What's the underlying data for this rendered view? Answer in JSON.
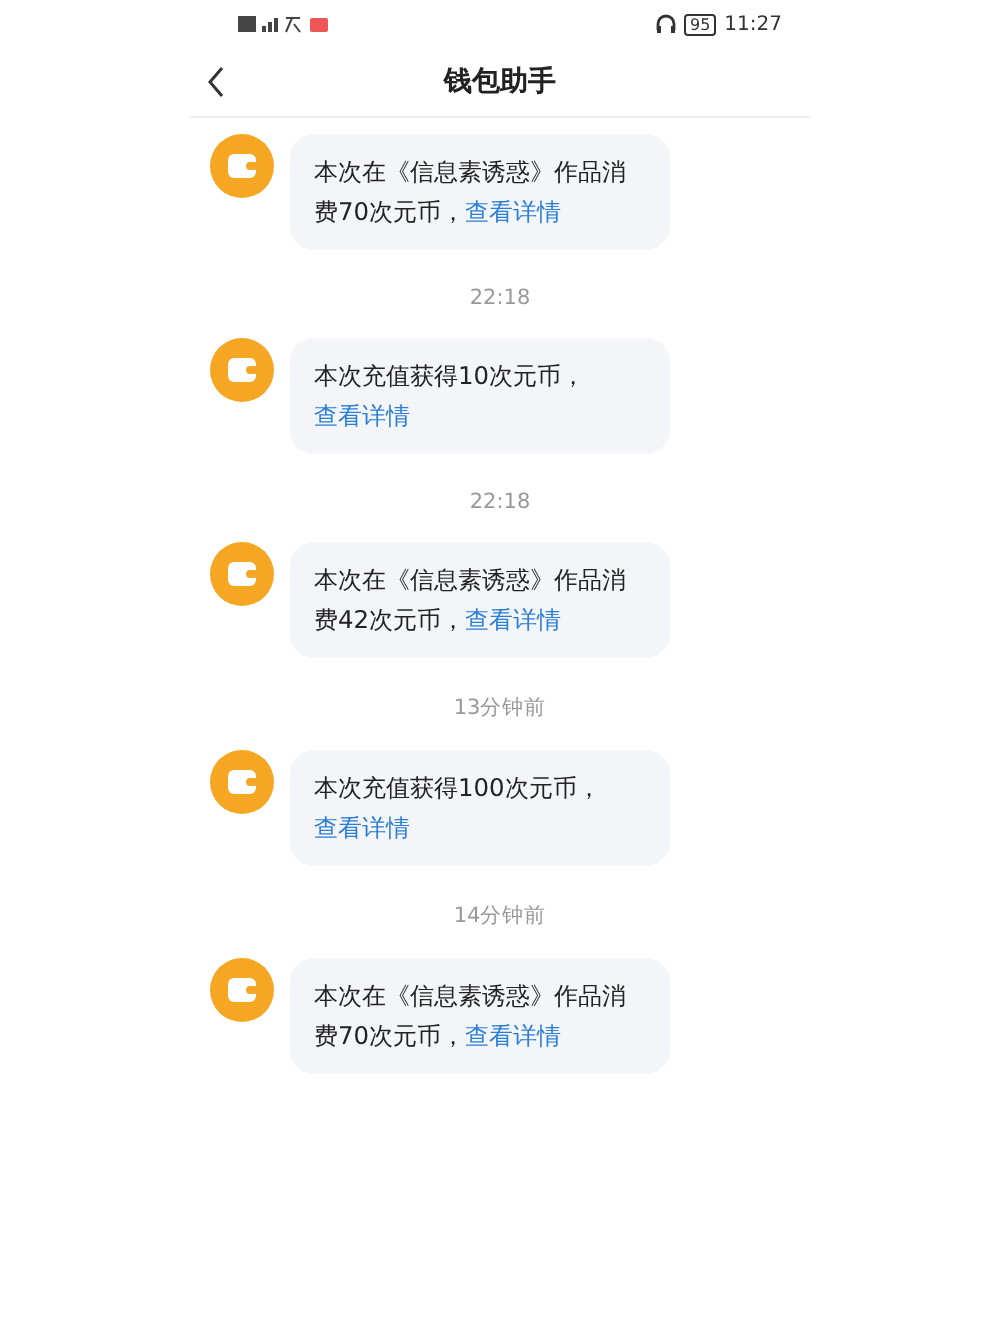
{
  "status_bar": {
    "battery": "95",
    "time": "11:27"
  },
  "header": {
    "title": "钱包助手"
  },
  "messages": [
    {
      "text": "本次在《信息素诱惑》作品消费70次元币，",
      "link": "查看详情"
    },
    {
      "time": "22:18",
      "text": "本次充值获得10次元币，",
      "link": "查看详情"
    },
    {
      "time": "22:18",
      "text": "本次在《信息素诱惑》作品消费42次元币，",
      "link": "查看详情"
    },
    {
      "time": "13分钟前",
      "text": "本次充值获得100次元币，",
      "link": "查看详情"
    },
    {
      "time": "14分钟前",
      "text": "本次在《信息素诱惑》作品消费70次元币，",
      "link": "查看详情"
    }
  ]
}
